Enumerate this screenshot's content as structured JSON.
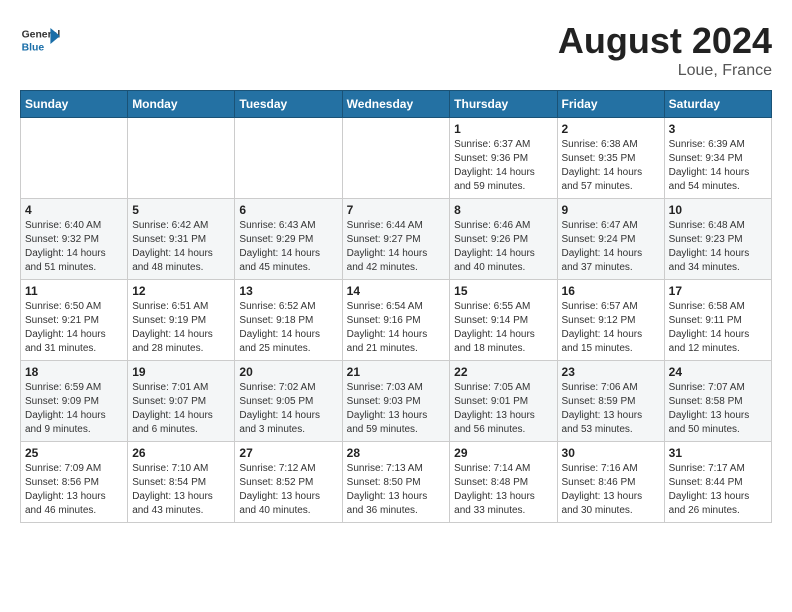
{
  "header": {
    "logo_general": "General",
    "logo_blue": "Blue",
    "month_year": "August 2024",
    "location": "Loue, France"
  },
  "weekdays": [
    "Sunday",
    "Monday",
    "Tuesday",
    "Wednesday",
    "Thursday",
    "Friday",
    "Saturday"
  ],
  "weeks": [
    [
      {
        "day": "",
        "info": ""
      },
      {
        "day": "",
        "info": ""
      },
      {
        "day": "",
        "info": ""
      },
      {
        "day": "",
        "info": ""
      },
      {
        "day": "1",
        "info": "Sunrise: 6:37 AM\nSunset: 9:36 PM\nDaylight: 14 hours\nand 59 minutes."
      },
      {
        "day": "2",
        "info": "Sunrise: 6:38 AM\nSunset: 9:35 PM\nDaylight: 14 hours\nand 57 minutes."
      },
      {
        "day": "3",
        "info": "Sunrise: 6:39 AM\nSunset: 9:34 PM\nDaylight: 14 hours\nand 54 minutes."
      }
    ],
    [
      {
        "day": "4",
        "info": "Sunrise: 6:40 AM\nSunset: 9:32 PM\nDaylight: 14 hours\nand 51 minutes."
      },
      {
        "day": "5",
        "info": "Sunrise: 6:42 AM\nSunset: 9:31 PM\nDaylight: 14 hours\nand 48 minutes."
      },
      {
        "day": "6",
        "info": "Sunrise: 6:43 AM\nSunset: 9:29 PM\nDaylight: 14 hours\nand 45 minutes."
      },
      {
        "day": "7",
        "info": "Sunrise: 6:44 AM\nSunset: 9:27 PM\nDaylight: 14 hours\nand 42 minutes."
      },
      {
        "day": "8",
        "info": "Sunrise: 6:46 AM\nSunset: 9:26 PM\nDaylight: 14 hours\nand 40 minutes."
      },
      {
        "day": "9",
        "info": "Sunrise: 6:47 AM\nSunset: 9:24 PM\nDaylight: 14 hours\nand 37 minutes."
      },
      {
        "day": "10",
        "info": "Sunrise: 6:48 AM\nSunset: 9:23 PM\nDaylight: 14 hours\nand 34 minutes."
      }
    ],
    [
      {
        "day": "11",
        "info": "Sunrise: 6:50 AM\nSunset: 9:21 PM\nDaylight: 14 hours\nand 31 minutes."
      },
      {
        "day": "12",
        "info": "Sunrise: 6:51 AM\nSunset: 9:19 PM\nDaylight: 14 hours\nand 28 minutes."
      },
      {
        "day": "13",
        "info": "Sunrise: 6:52 AM\nSunset: 9:18 PM\nDaylight: 14 hours\nand 25 minutes."
      },
      {
        "day": "14",
        "info": "Sunrise: 6:54 AM\nSunset: 9:16 PM\nDaylight: 14 hours\nand 21 minutes."
      },
      {
        "day": "15",
        "info": "Sunrise: 6:55 AM\nSunset: 9:14 PM\nDaylight: 14 hours\nand 18 minutes."
      },
      {
        "day": "16",
        "info": "Sunrise: 6:57 AM\nSunset: 9:12 PM\nDaylight: 14 hours\nand 15 minutes."
      },
      {
        "day": "17",
        "info": "Sunrise: 6:58 AM\nSunset: 9:11 PM\nDaylight: 14 hours\nand 12 minutes."
      }
    ],
    [
      {
        "day": "18",
        "info": "Sunrise: 6:59 AM\nSunset: 9:09 PM\nDaylight: 14 hours\nand 9 minutes."
      },
      {
        "day": "19",
        "info": "Sunrise: 7:01 AM\nSunset: 9:07 PM\nDaylight: 14 hours\nand 6 minutes."
      },
      {
        "day": "20",
        "info": "Sunrise: 7:02 AM\nSunset: 9:05 PM\nDaylight: 14 hours\nand 3 minutes."
      },
      {
        "day": "21",
        "info": "Sunrise: 7:03 AM\nSunset: 9:03 PM\nDaylight: 13 hours\nand 59 minutes."
      },
      {
        "day": "22",
        "info": "Sunrise: 7:05 AM\nSunset: 9:01 PM\nDaylight: 13 hours\nand 56 minutes."
      },
      {
        "day": "23",
        "info": "Sunrise: 7:06 AM\nSunset: 8:59 PM\nDaylight: 13 hours\nand 53 minutes."
      },
      {
        "day": "24",
        "info": "Sunrise: 7:07 AM\nSunset: 8:58 PM\nDaylight: 13 hours\nand 50 minutes."
      }
    ],
    [
      {
        "day": "25",
        "info": "Sunrise: 7:09 AM\nSunset: 8:56 PM\nDaylight: 13 hours\nand 46 minutes."
      },
      {
        "day": "26",
        "info": "Sunrise: 7:10 AM\nSunset: 8:54 PM\nDaylight: 13 hours\nand 43 minutes."
      },
      {
        "day": "27",
        "info": "Sunrise: 7:12 AM\nSunset: 8:52 PM\nDaylight: 13 hours\nand 40 minutes."
      },
      {
        "day": "28",
        "info": "Sunrise: 7:13 AM\nSunset: 8:50 PM\nDaylight: 13 hours\nand 36 minutes."
      },
      {
        "day": "29",
        "info": "Sunrise: 7:14 AM\nSunset: 8:48 PM\nDaylight: 13 hours\nand 33 minutes."
      },
      {
        "day": "30",
        "info": "Sunrise: 7:16 AM\nSunset: 8:46 PM\nDaylight: 13 hours\nand 30 minutes."
      },
      {
        "day": "31",
        "info": "Sunrise: 7:17 AM\nSunset: 8:44 PM\nDaylight: 13 hours\nand 26 minutes."
      }
    ]
  ]
}
